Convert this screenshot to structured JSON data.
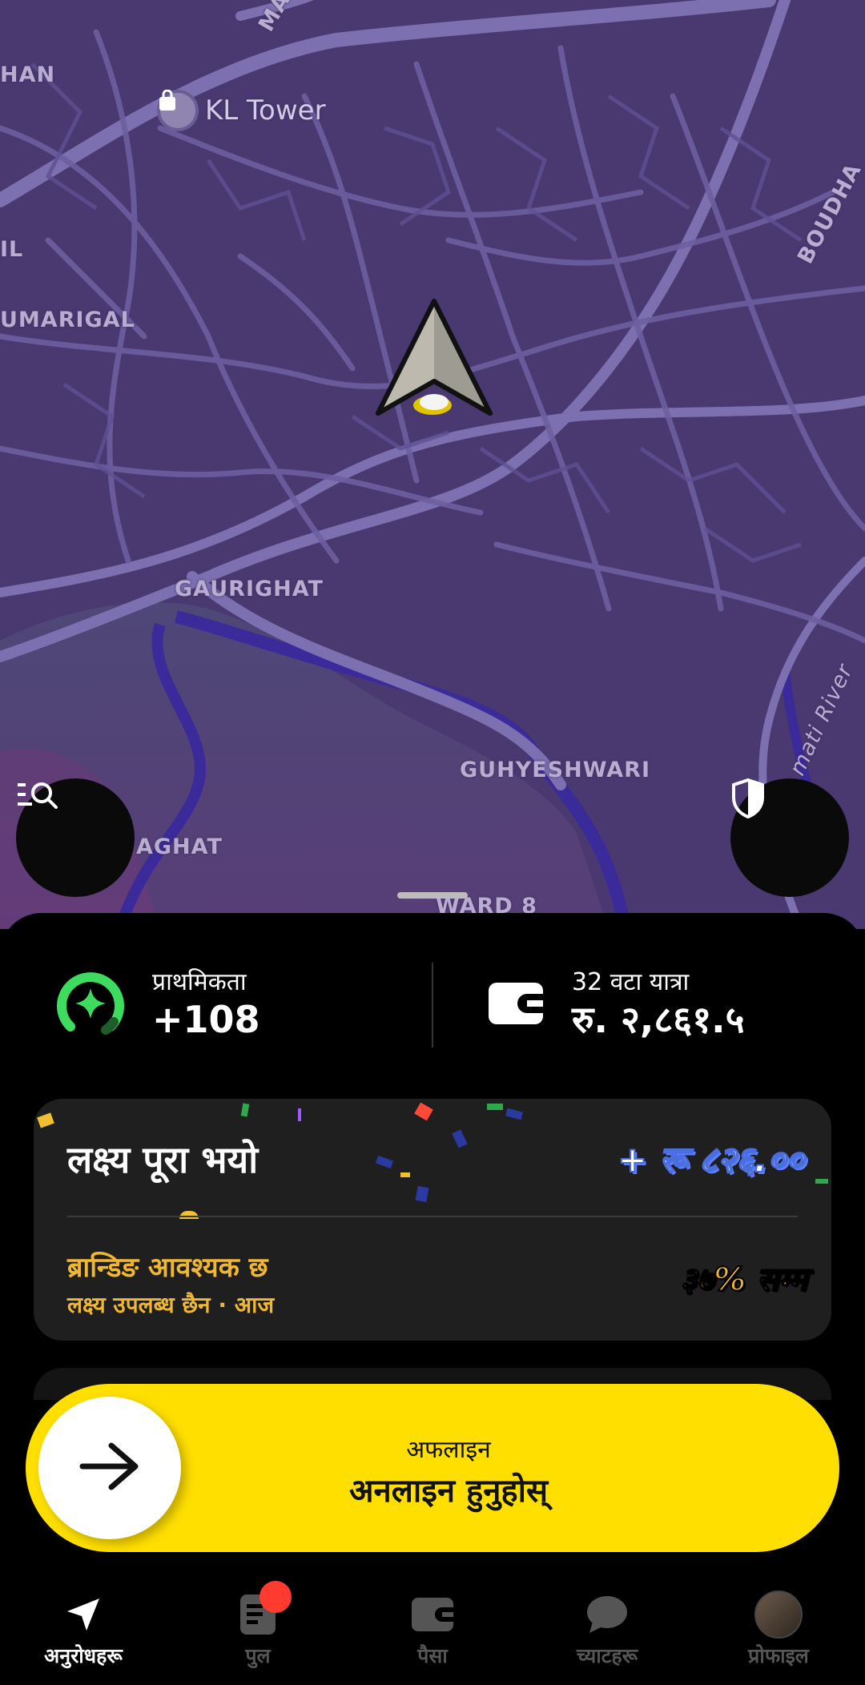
{
  "map": {
    "labels": {
      "ma": "MA",
      "han": "HAN",
      "il": "IL",
      "umarigal": "UMARIGAL",
      "boudha": "BOUDHA",
      "gaurighat": "GAURIGHAT",
      "guhyeshwari": "GUHYESHWARI",
      "aghat": "AGHAT",
      "ward8": "WARD 8",
      "river": "mati River"
    },
    "poi": {
      "label": "KL Tower",
      "icon": "shopping-bag-icon"
    },
    "left_button_icon": "search-list-icon",
    "right_button_icon": "shield-icon"
  },
  "stats": {
    "priority": {
      "caption": "प्राथमिकता",
      "value": "+108",
      "icon": "priority-gauge-icon",
      "color": "#3ddc5f"
    },
    "earnings": {
      "caption": "32 वटा यात्रा",
      "value": "रु. २,८६१.५",
      "icon": "wallet-icon"
    }
  },
  "goal": {
    "title": "लक्ष्य पूरा भयो",
    "amount": "+ रू ८२६.००",
    "branding_required": "ब्रान्डिङ आवश्यक छ",
    "goal_unavailable": "लक्ष्य उपलब्ध छैन · आज",
    "badge": "३७% सम्म",
    "accent": "#f0b732"
  },
  "go_online": {
    "status": "अफलाइन",
    "action": "अनलाइन हुनुहोस्",
    "color": "#ffdf00"
  },
  "nav": {
    "items": [
      {
        "label": "अनुरोधहरू",
        "icon": "navigation-arrow-icon",
        "active": true
      },
      {
        "label": "पुल",
        "icon": "pool-list-icon",
        "active": false,
        "badge": true
      },
      {
        "label": "पैसा",
        "icon": "wallet-icon",
        "active": false
      },
      {
        "label": "च्याटहरू",
        "icon": "chat-bubble-icon",
        "active": false
      },
      {
        "label": "प्रोफाइल",
        "icon": "avatar",
        "active": false
      }
    ]
  }
}
